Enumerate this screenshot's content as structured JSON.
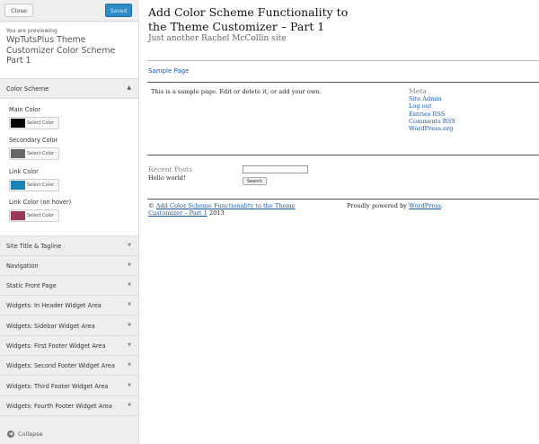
{
  "header": {
    "close_label": "Close",
    "saved_label": "Saved"
  },
  "preview_info": {
    "label": "You are previewing",
    "theme_name": "WpTutsPlus Theme Customizer Color Scheme Part 1"
  },
  "color_scheme": {
    "title": "Color Scheme",
    "expanded_icon": "▲",
    "fields": [
      {
        "label": "Main Color",
        "color": "#000000",
        "button": "Select Color"
      },
      {
        "label": "Secondary Color",
        "color": "#666666",
        "button": "Select Color"
      },
      {
        "label": "Link Color",
        "color": "#1b82b4",
        "button": "Select Color"
      },
      {
        "label": "Link Color (on hover)",
        "color": "#9b3a55",
        "button": "Select Color"
      }
    ]
  },
  "sections": [
    {
      "label": "Site Title & Tagline"
    },
    {
      "label": "Navigation"
    },
    {
      "label": "Static Front Page"
    },
    {
      "label": "Widgets: In Header Widget Area"
    },
    {
      "label": "Widgets: Sidebar Widget Area"
    },
    {
      "label": "Widgets: First Footer Widget Area"
    },
    {
      "label": "Widgets: Second Footer Widget Area"
    },
    {
      "label": "Widgets: Third Footer Widget Area"
    },
    {
      "label": "Widgets: Fourth Footer Widget Area"
    }
  ],
  "collapse_label": "Collapse",
  "site": {
    "title": "Add Color Scheme Functionality to the Theme Customizer – Part 1",
    "description": "Just another Rachel McCollin site",
    "menu_link": "Sample Page",
    "content": "This is a sample page. Edit or delete it, or add your own.",
    "meta_heading": "Meta",
    "meta_links": [
      "Site Admin",
      "Log out",
      "Entries RSS",
      "Comments RSS",
      "WordPress.org"
    ],
    "recent_heading": "Recent Posts",
    "recent_post": "Hello world!",
    "search_button": "Search",
    "footer_copy": "©",
    "footer_link": "Add Color Scheme Functionality to the Theme Customizer – Part 1",
    "footer_year": "2013",
    "footer_powered": "Proudly powered by",
    "footer_wp": "WordPress",
    "footer_dot": "."
  }
}
